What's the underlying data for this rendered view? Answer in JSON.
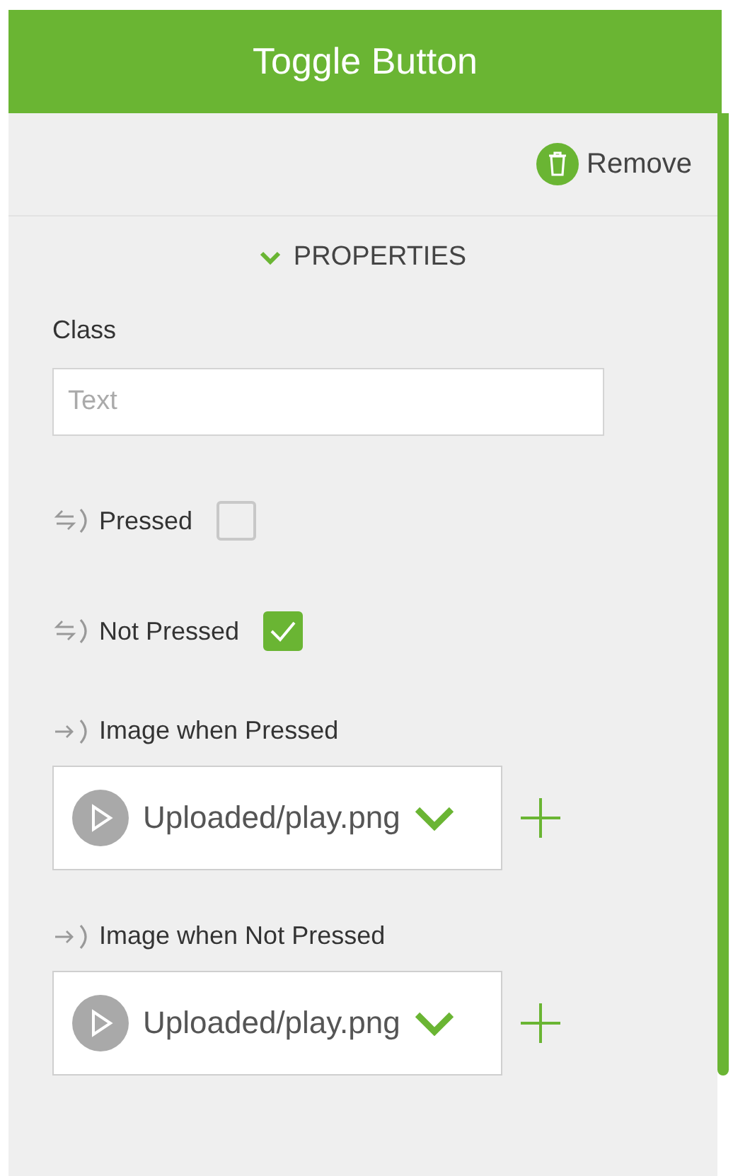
{
  "header": {
    "title": "Toggle Button"
  },
  "remove_button": {
    "label": "Remove"
  },
  "section": {
    "title": "PROPERTIES",
    "expanded": true
  },
  "properties": [
    {
      "kind": "text",
      "label": "Class",
      "placeholder": "Text"
    },
    {
      "kind": "checkbox",
      "label": "Pressed",
      "checked": false
    },
    {
      "kind": "checkbox",
      "label": "Not Pressed",
      "checked": true
    },
    {
      "kind": "image",
      "label": "Image when Pressed",
      "value": "Uploaded/play.png"
    },
    {
      "kind": "image",
      "label": "Image when Not Pressed",
      "value": "Uploaded/play.png"
    }
  ]
}
